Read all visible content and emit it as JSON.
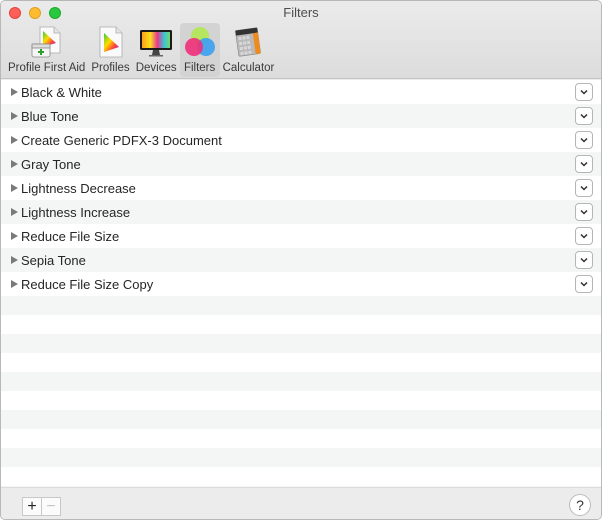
{
  "window": {
    "title": "Filters"
  },
  "toolbar": {
    "items": [
      {
        "label": "Profile First Aid",
        "icon": "profile-first-aid-icon",
        "active": false
      },
      {
        "label": "Profiles",
        "icon": "profiles-icon",
        "active": false
      },
      {
        "label": "Devices",
        "icon": "devices-icon",
        "active": false
      },
      {
        "label": "Filters",
        "icon": "filters-icon",
        "active": true
      },
      {
        "label": "Calculator",
        "icon": "calculator-icon",
        "active": false
      }
    ]
  },
  "filters": {
    "items": [
      {
        "label": "Black & White"
      },
      {
        "label": "Blue Tone"
      },
      {
        "label": "Create Generic PDFX-3 Document"
      },
      {
        "label": "Gray Tone"
      },
      {
        "label": "Lightness Decrease"
      },
      {
        "label": "Lightness Increase"
      },
      {
        "label": "Reduce File Size"
      },
      {
        "label": "Sepia Tone"
      },
      {
        "label": "Reduce File Size Copy"
      }
    ]
  },
  "footer": {
    "add_label": "+",
    "remove_label": "−",
    "help_label": "?"
  }
}
